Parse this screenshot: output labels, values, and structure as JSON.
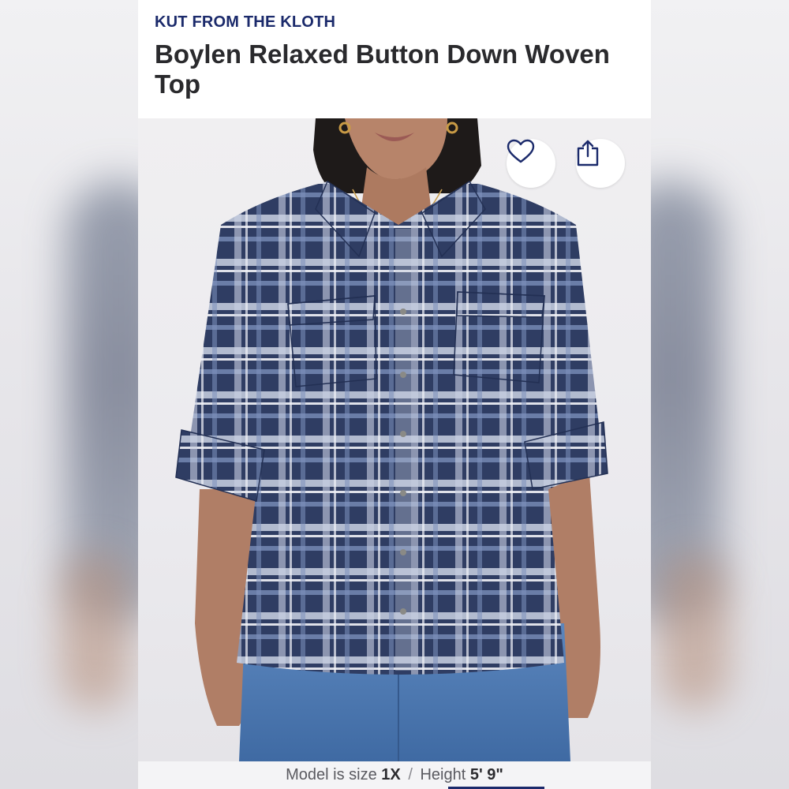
{
  "product": {
    "brand": "KUT FROM THE KLOTH",
    "title": "Boylen Relaxed Button Down Woven Top"
  },
  "actions": {
    "favorite_icon": "heart-icon",
    "share_icon": "share-icon"
  },
  "model_info": {
    "size_label": "Model is size",
    "size_value": "1X",
    "separator": "/",
    "height_label": "Height",
    "height_value": "5' 9\""
  },
  "colors": {
    "brand": "#1b2a6b",
    "title": "#2a2a2d",
    "shirt_plaid": "#2f3d63"
  }
}
